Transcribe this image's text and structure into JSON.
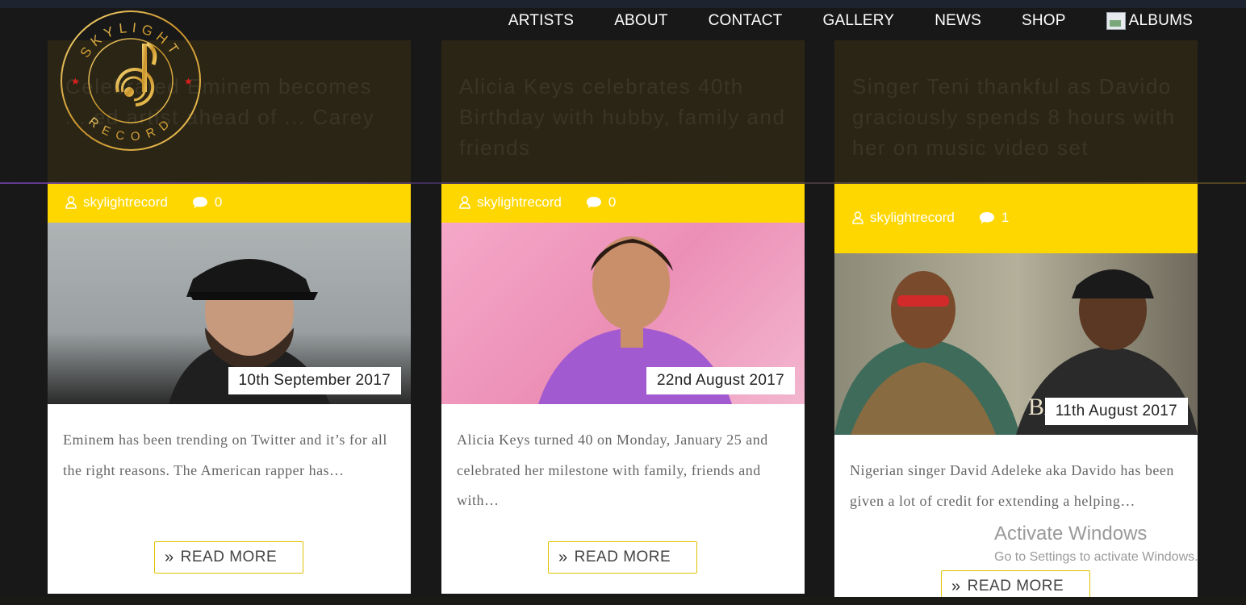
{
  "nav": {
    "items": [
      "ARTISTS",
      "ABOUT",
      "CONTACT",
      "GALLERY",
      "NEWS",
      "SHOP"
    ],
    "albums_label": "ALBUMS"
  },
  "logo": {
    "brand_top": "SKYLIGHT",
    "brand_bottom": "RECORD"
  },
  "posts": [
    {
      "title": "Celebrated Eminem becomes ... ed artist ahead of ... Carey",
      "author": "skylightrecord",
      "comments": "0",
      "date": "10th September 2017",
      "excerpt": "Eminem has been trending on Twitter and it’s for all the right reasons. The American rapper has…",
      "read_more": "READ MORE"
    },
    {
      "title": "Alicia Keys celebrates 40th Birthday with hubby, family and friends",
      "author": "skylightrecord",
      "comments": "0",
      "date": "22nd August 2017",
      "excerpt": "Alicia Keys turned 40 on Monday, January 25 and celebrated her milestone with family, friends and with…",
      "read_more": "READ MORE"
    },
    {
      "title": "Singer Teni thankful as Davido graciously spends 8 hours with her on music video set",
      "author": "skylightrecord",
      "comments": "1",
      "date": "11th August 2017",
      "excerpt": "Nigerian singer David Adeleke aka Davido has been given a lot of credit for extending a helping…",
      "read_more": "READ MORE"
    }
  ],
  "watermark": {
    "title": "Activate Windows",
    "subtitle": "Go to Settings to activate Windows."
  },
  "colors": {
    "accent_yellow": "#ffd700",
    "page_bg": "#181818",
    "card_head": "#2a2515"
  }
}
